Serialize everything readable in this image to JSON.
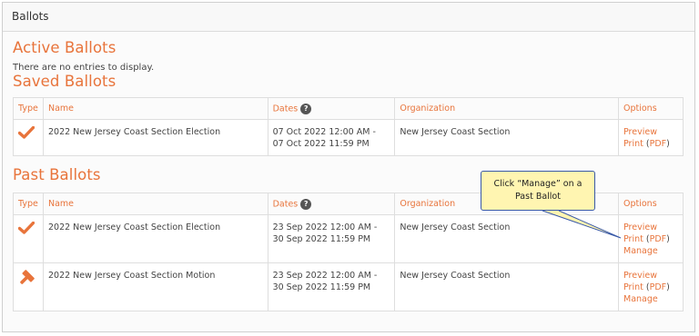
{
  "panel": {
    "title": "Ballots"
  },
  "active": {
    "title": "Active Ballots",
    "empty": "There are no entries to display."
  },
  "saved": {
    "title": "Saved Ballots",
    "headers": {
      "type": "Type",
      "name": "Name",
      "dates": "Dates",
      "org": "Organization",
      "options": "Options"
    },
    "rows": [
      {
        "icon": "checkmark-icon",
        "name": "2022 New Jersey Coast Section Election",
        "date_start": "07 Oct 2022 12:00 AM -",
        "date_end": "07 Oct 2022 11:59 PM",
        "org": "New Jersey Coast Section",
        "preview": "Preview",
        "print": "Print",
        "pdf": "PDF"
      }
    ]
  },
  "past": {
    "title": "Past Ballots",
    "headers": {
      "type": "Type",
      "name": "Name",
      "dates": "Dates",
      "org": "Organization",
      "options": "Options"
    },
    "rows": [
      {
        "icon": "checkmark-icon",
        "name": "2022 New Jersey Coast Section Election",
        "date_start": "23 Sep 2022 12:00 AM -",
        "date_end": "30 Sep 2022 11:59 PM",
        "org": "New Jersey Coast Section",
        "preview": "Preview",
        "print": "Print",
        "pdf": "PDF",
        "manage": "Manage"
      },
      {
        "icon": "gavel-icon",
        "name": "2022 New Jersey Coast Section Motion",
        "date_start": "23 Sep 2022 12:00 AM -",
        "date_end": "30 Sep 2022 11:59 PM",
        "org": "New Jersey Coast Section",
        "preview": "Preview",
        "print": "Print",
        "pdf": "PDF",
        "manage": "Manage"
      }
    ]
  },
  "help_icon": "?",
  "callout": {
    "line1": "Click “Manage” on a",
    "line2": "Past Ballot"
  },
  "colors": {
    "accent": "#e8743b",
    "callout_bg": "#fff5b1",
    "callout_border": "#3a5aa8"
  }
}
